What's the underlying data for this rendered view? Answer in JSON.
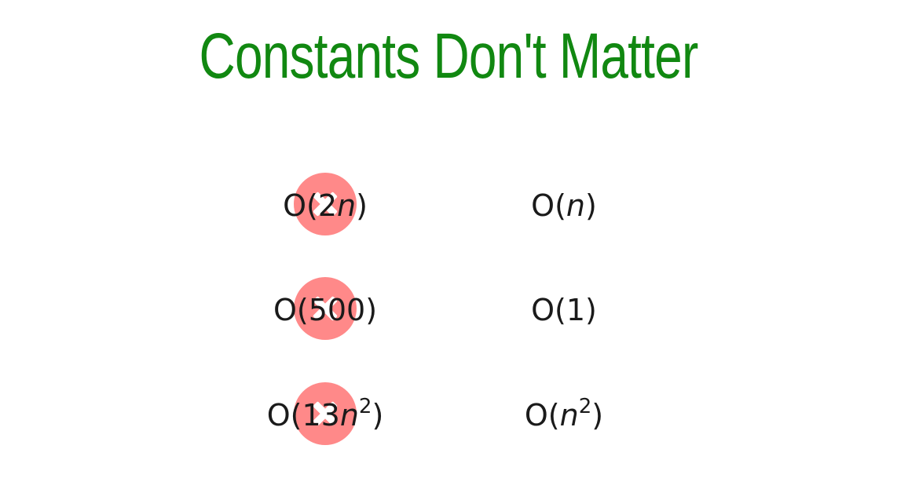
{
  "title": {
    "text": "Constants Don't Matter",
    "color": "#118811"
  },
  "marker": {
    "icon": "x-circle-icon",
    "color": "#ff7f7f"
  },
  "rows": [
    {
      "left": {
        "prefix": "O(2",
        "var": "n",
        "exp": "",
        "suffix": ")"
      },
      "right": {
        "prefix": "O(",
        "var": "n",
        "exp": "",
        "suffix": ")"
      }
    },
    {
      "left": {
        "prefix": "O(500)",
        "var": "",
        "exp": "",
        "suffix": ""
      },
      "right": {
        "prefix": "O(1)",
        "var": "",
        "exp": "",
        "suffix": ""
      }
    },
    {
      "left": {
        "prefix": "O(13",
        "var": "n",
        "exp": "2",
        "suffix": ")"
      },
      "right": {
        "prefix": "O(",
        "var": "n",
        "exp": "2",
        "suffix": ")"
      }
    }
  ]
}
